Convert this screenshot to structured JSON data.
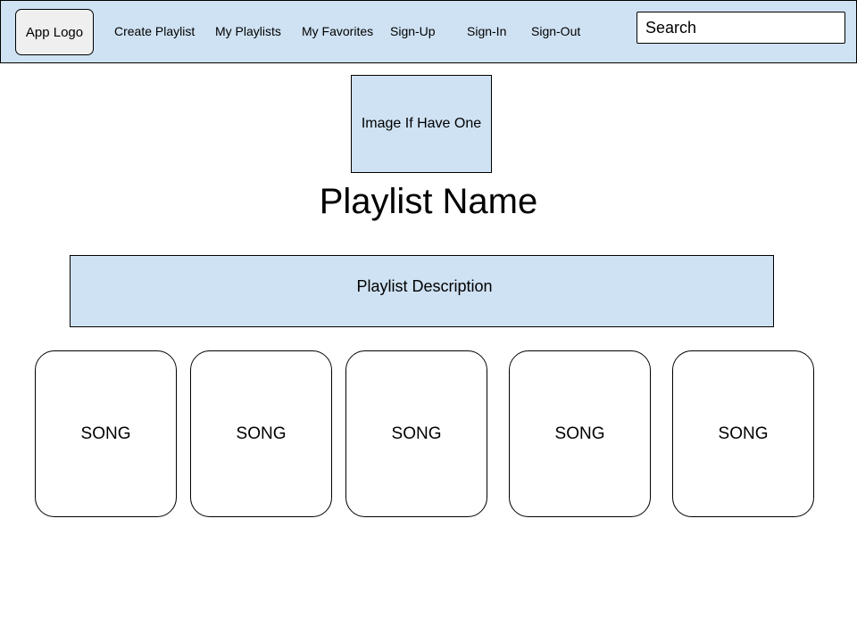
{
  "nav": {
    "logo_label": "App Logo",
    "links": [
      {
        "label": "Create Playlist"
      },
      {
        "label": "My Playlists"
      },
      {
        "label": "My Favorites"
      },
      {
        "label": "Sign-Up"
      },
      {
        "label": "Sign-In"
      },
      {
        "label": "Sign-Out"
      }
    ],
    "search": {
      "placeholder": "Search",
      "value": ""
    }
  },
  "playlist": {
    "image_label": "Image If Have One",
    "name": "Playlist Name",
    "description": "Playlist Description"
  },
  "songs": [
    {
      "label": "SONG"
    },
    {
      "label": "SONG"
    },
    {
      "label": "SONG"
    },
    {
      "label": "SONG"
    },
    {
      "label": "SONG"
    }
  ],
  "colors": {
    "panel": "#cfe2f3",
    "logo_bg": "#efefef",
    "border": "#000000"
  }
}
